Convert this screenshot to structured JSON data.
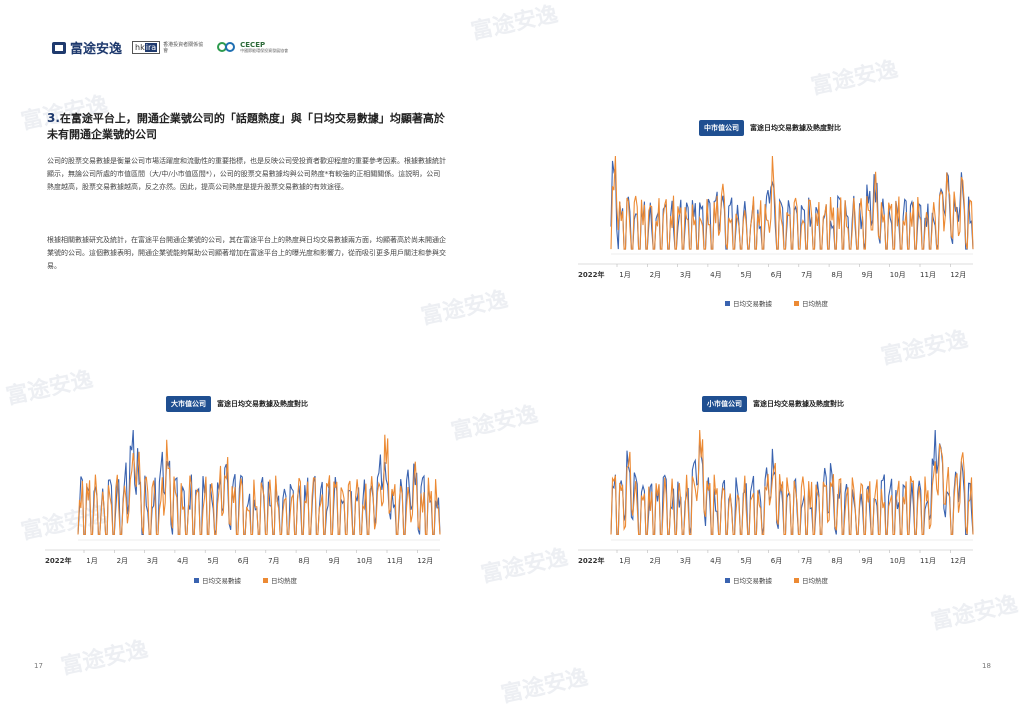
{
  "watermark_text": "富途安逸",
  "logos": {
    "futu": "富途安逸",
    "hkira_box_a": "hk",
    "hkira_box_b": "ira",
    "hkira_sub": "香港投資者關係協會",
    "cecep": "CECEP",
    "cecep_sub": "中國節能環保投資發展協會"
  },
  "section": {
    "number": "3.",
    "title": "在富途平台上，開通企業號公司的「話題熱度」與「日均交易數據」均顯著高於未有開通企業號的公司",
    "paragraph1": "公司的股票交易數據是衡量公司市場活躍度和流動性的重要指標，也是反映公司受投資者歡迎程度的重要參考因素。根據數據統計顯示，無論公司所處的市值區間（大/中/小市值區間*），公司的股票交易數據均與公司熱度*有較強的正相關關係。這説明，公司熱度越高，股票交易數據越高，反之亦然。因此，提高公司熱度是提升股票交易數據的有效途徑。",
    "paragraph2": "根據相關數據研究及統計，在富途平台開通企業號的公司，其在富途平台上的熱度與日均交易數據兩方面，均顯著高於尚未開通企業號的公司。這個數據表明，開通企業號能夠幫助公司顯著增加在富途平台上的曝光度和影響力，從而吸引更多用戶關注和參與交易。"
  },
  "colors": {
    "volume": "#3a63b0",
    "heat": "#ec8a34",
    "tag": "#1f4f91"
  },
  "charts": [
    {
      "tag": "中市值公司",
      "title": "富途日均交易數據及熱度對比",
      "year_label": "2022年",
      "months": [
        "1月",
        "2月",
        "3月",
        "4月",
        "5月",
        "6月",
        "7月",
        "8月",
        "9月",
        "10月",
        "11月",
        "12月"
      ],
      "legend": [
        "日均交易數據",
        "日均熱度"
      ]
    },
    {
      "tag": "大市值公司",
      "title": "富途日均交易數據及熱度對比",
      "year_label": "2022年",
      "months": [
        "1月",
        "2月",
        "3月",
        "4月",
        "5月",
        "6月",
        "7月",
        "8月",
        "9月",
        "10月",
        "11月",
        "12月"
      ],
      "legend": [
        "日均交易數據",
        "日均熱度"
      ]
    },
    {
      "tag": "小市值公司",
      "title": "富途日均交易數據及熱度對比",
      "year_label": "2022年",
      "months": [
        "1月",
        "2月",
        "3月",
        "4月",
        "5月",
        "6月",
        "7月",
        "8月",
        "9月",
        "10月",
        "11月",
        "12月"
      ],
      "legend": [
        "日均交易數據",
        "日均熱度"
      ]
    }
  ],
  "page_numbers": {
    "left": "17",
    "right": "18"
  }
}
